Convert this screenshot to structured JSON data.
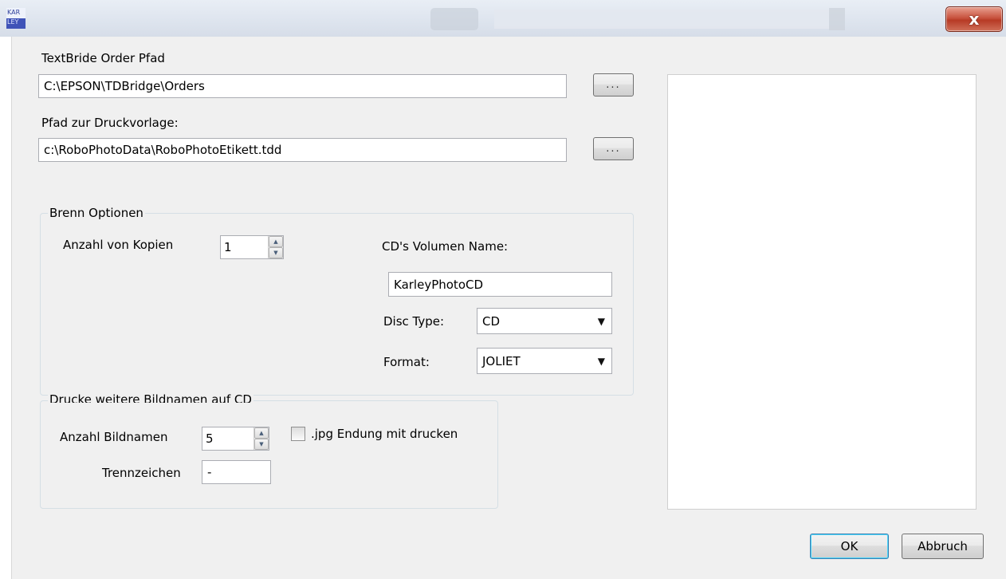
{
  "window": {
    "logo_line1": "KAR",
    "logo_line2": "LEY",
    "close_glyph": "x"
  },
  "paths": {
    "order_label": "TextBride Order Pfad",
    "order_value": "C:\\EPSON\\TDBridge\\Orders",
    "template_label": "Pfad zur Druckvorlage:",
    "template_value": "c:\\RoboPhotoData\\RoboPhotoEtikett.tdd",
    "browse_label": "..."
  },
  "burn_options": {
    "title": "Brenn Optionen",
    "copies_label": "Anzahl von Kopien",
    "copies_value": "1",
    "volume_label": "CD's Volumen Name:",
    "volume_value": "KarleyPhotoCD",
    "disc_type_label": "Disc Type:",
    "disc_type_value": "CD",
    "format_label": "Format:",
    "format_value": "JOLIET"
  },
  "image_names": {
    "title": "Drucke weitere Bildnamen auf CD",
    "count_label": "Anzahl Bildnamen",
    "count_value": "5",
    "jpg_label": ".jpg Endung mit drucken",
    "jpg_checked": false,
    "separator_label": "Trennzeichen",
    "separator_value": "-"
  },
  "dialog_buttons": {
    "ok": "OK",
    "cancel": "Abbruch"
  },
  "colors": {
    "close_button": "#c8523e",
    "ok_focus_border": "#3c7fb1",
    "background": "#f0f0f0"
  },
  "icons": [
    "app-logo-icon",
    "close-icon",
    "spin-up-icon",
    "spin-down-icon",
    "dropdown-caret-icon"
  ]
}
